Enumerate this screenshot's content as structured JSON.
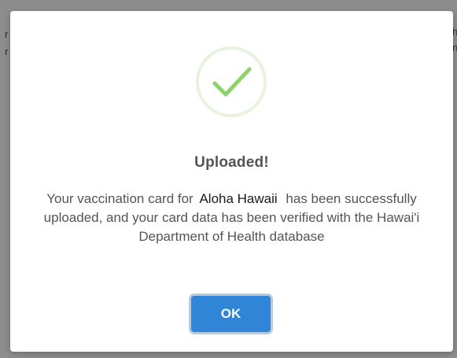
{
  "background_page": {
    "left_fragments": [
      "r",
      "r"
    ],
    "right_fragments": [
      "h",
      "n"
    ]
  },
  "dialog": {
    "icon": "checkmark-circle-icon",
    "icon_color": "#8fd16f",
    "icon_ring_color": "#e7f3df",
    "title": "Uploaded!",
    "message_before": "Your vaccination card for",
    "app_name": "Aloha Hawaii",
    "message_after": "has been successfully uploaded, and your card data has been verified with the Hawai'i Department of Health database",
    "ok_label": "OK",
    "ok_color": "#3085d6"
  }
}
